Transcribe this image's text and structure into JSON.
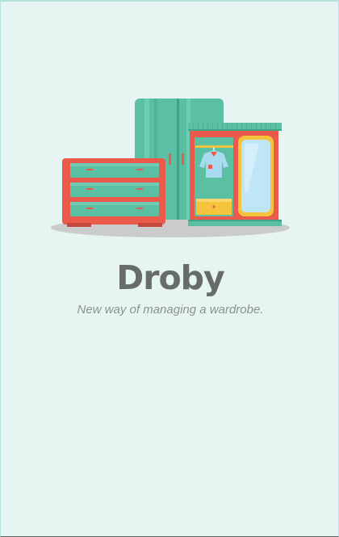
{
  "app": {
    "name": "Droby",
    "tagline": "New way of managing a wardrobe."
  },
  "illustration": {
    "icon": "wardrobe-furniture-illustration",
    "colors": {
      "teal": "#5bbfa3",
      "teal_dark": "#3ea488",
      "red": "#ec5a4b",
      "yellow": "#f6c43c",
      "mirror_blue": "#bfe6f6",
      "shadow": "#c9cccb"
    }
  },
  "theme": {
    "background": "#e6f4f2",
    "title_color": "#676c6b",
    "tagline_color": "#8a9291"
  }
}
